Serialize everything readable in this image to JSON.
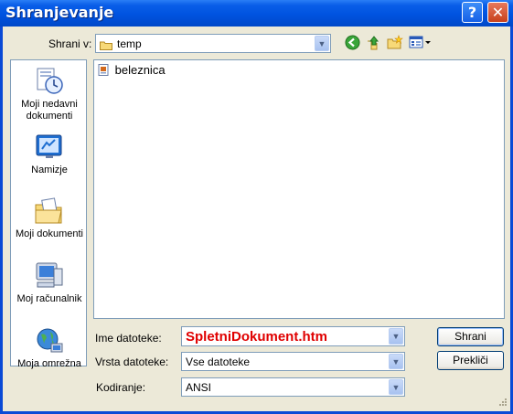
{
  "window": {
    "title": "Shranjevanje",
    "help_glyph": "?",
    "close_glyph": "✕"
  },
  "location": {
    "label": "Shrani v:",
    "value": "temp"
  },
  "toolbar": {
    "back_icon": "back-arrow-icon",
    "up_icon": "up-folder-icon",
    "new_folder_icon": "new-folder-icon",
    "views_icon": "views-menu-icon"
  },
  "places": [
    {
      "name": "recent",
      "label": "Moji nedavni dokumenti",
      "icon": "recent-documents-icon"
    },
    {
      "name": "desktop",
      "label": "Namizje",
      "icon": "desktop-icon"
    },
    {
      "name": "my-documents",
      "label": "Moji dokumenti",
      "icon": "my-documents-icon"
    },
    {
      "name": "my-computer",
      "label": "Moj računalnik",
      "icon": "my-computer-icon"
    },
    {
      "name": "network",
      "label": "Moja omrežna",
      "icon": "network-icon"
    }
  ],
  "files": [
    {
      "name": "beleznica",
      "icon": "file-icon"
    }
  ],
  "form": {
    "filename_label": "Ime datoteke:",
    "filename_value": "SpletniDokument.htm",
    "filetype_label": "Vrsta datoteke:",
    "filetype_value": "Vse datoteke",
    "encoding_label": "Kodiranje:",
    "encoding_value": "ANSI"
  },
  "buttons": {
    "save": "Shrani",
    "cancel": "Prekliči"
  },
  "colors": {
    "titlebar": "#0054e3",
    "client": "#ece9d8",
    "filename_text": "#e00000"
  }
}
